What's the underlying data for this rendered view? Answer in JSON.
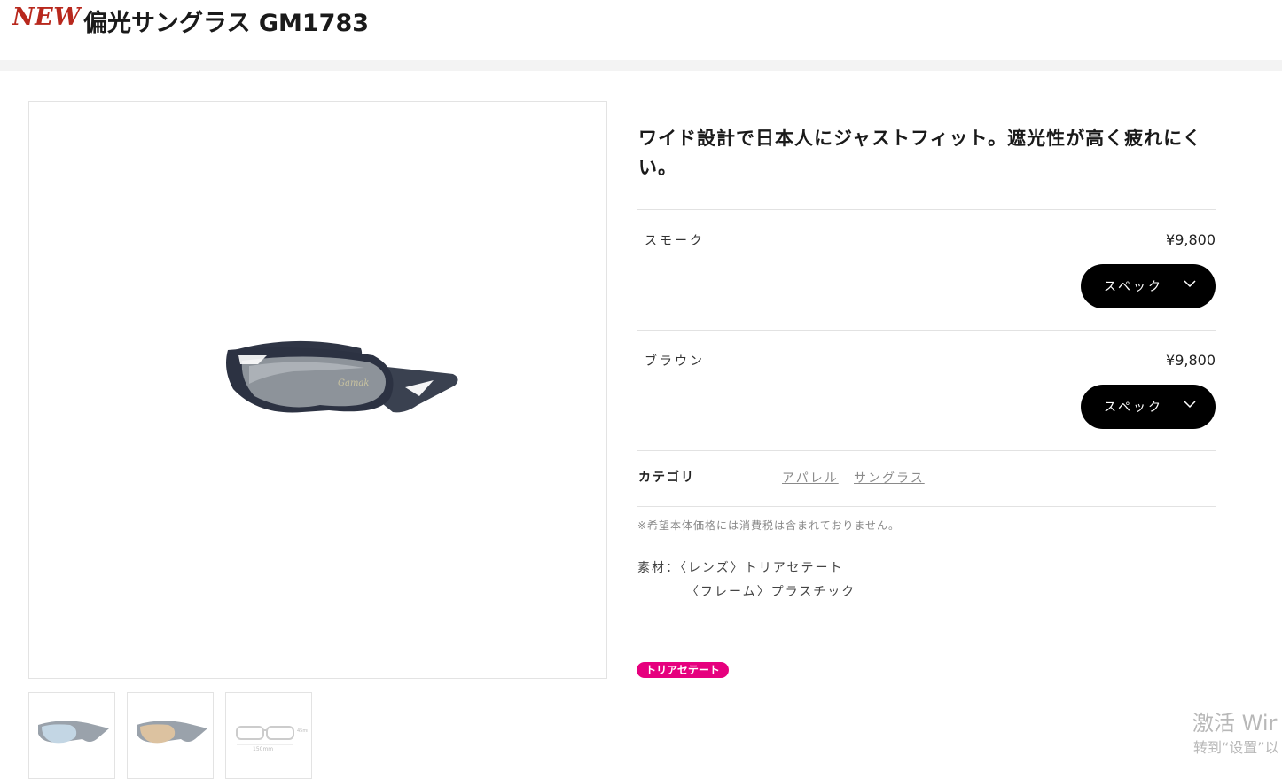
{
  "header": {
    "new_label": "NEW",
    "title": "偏光サングラス GM1783"
  },
  "product": {
    "description": "ワイド設計で日本人にジャストフィット。遮光性が高く疲れにくい。",
    "variants": [
      {
        "name": "スモーク",
        "price": "¥9,800",
        "spec_label": "スペック"
      },
      {
        "name": "ブラウン",
        "price": "¥9,800",
        "spec_label": "スペック"
      }
    ],
    "category": {
      "label": "カテゴリ",
      "links": [
        "アパレル",
        "サングラス"
      ]
    },
    "tax_note": "※希望本体価格には消費税は含まれておりません。",
    "material": {
      "line1": "素材：〈レンズ〉トリアセテート",
      "line2": "〈フレーム〉プラスチック"
    },
    "tag": "トリアセテート"
  },
  "thumbnails": {
    "dims_width": "150mm",
    "dims_height": "45mm"
  },
  "watermark": {
    "line1": "激活 Wir",
    "line2": "转到“设置”以"
  },
  "colors": {
    "accent_red": "#b8281d",
    "tag_pink": "#e6007e",
    "button_black": "#000000"
  },
  "icons": {
    "chevron": "chevron-down-icon"
  }
}
